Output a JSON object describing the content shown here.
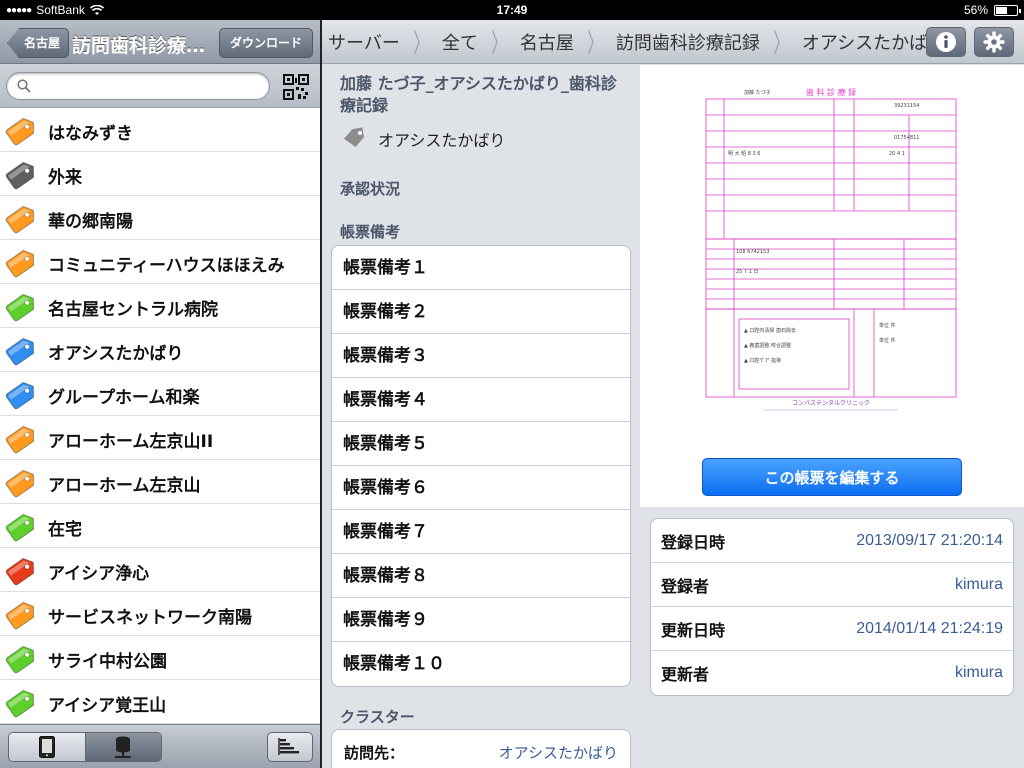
{
  "status": {
    "carrier": "SoftBank",
    "time": "17:49",
    "battery": "56%",
    "battery_level": 0.56
  },
  "left": {
    "back_label": "名古屋",
    "title": "訪問歯科診療…",
    "download_label": "ダウンロード",
    "search": {
      "placeholder": "",
      "value": ""
    },
    "items": [
      {
        "label": "はなみずき",
        "color": "#ff9a1f"
      },
      {
        "label": "外来",
        "color": "#5f5f5f"
      },
      {
        "label": "華の郷南陽",
        "color": "#ff9a1f"
      },
      {
        "label": "コミュニティーハウスほほえみ",
        "color": "#ff9a1f"
      },
      {
        "label": "名古屋セントラル病院",
        "color": "#5fcf2a"
      },
      {
        "label": "オアシスたかばり",
        "color": "#2f8ef0"
      },
      {
        "label": "グループホーム和楽",
        "color": "#2f8ef0"
      },
      {
        "label": "アローホーム左京山II",
        "color": "#ff9a1f"
      },
      {
        "label": "アローホーム左京山",
        "color": "#ff9a1f"
      },
      {
        "label": "在宅",
        "color": "#5fcf2a"
      },
      {
        "label": "アイシア浄心",
        "color": "#e83a1a"
      },
      {
        "label": "サービスネットワーク南陽",
        "color": "#ff9a1f"
      },
      {
        "label": "サライ中村公園",
        "color": "#5fcf2a"
      },
      {
        "label": "アイシア覚王山",
        "color": "#5fcf2a"
      }
    ]
  },
  "breadcrumb": [
    "サーバー",
    "全て",
    "名古屋",
    "訪問歯科診療記録",
    "オアシスたかばり"
  ],
  "doc": {
    "title": "加藤 たづ子_オアシスたかばり_歯科診療記録",
    "tag": "オアシスたかばり",
    "approval_header": "承認状況",
    "remarks_header": "帳票備考",
    "remarks": [
      "帳票備考１",
      "帳票備考２",
      "帳票備考３",
      "帳票備考４",
      "帳票備考５",
      "帳票備考６",
      "帳票備考７",
      "帳票備考８",
      "帳票備考９",
      "帳票備考１０"
    ],
    "cluster_header": "クラスター",
    "cluster": {
      "key": "訪問先：",
      "value": "オアシスたかばり"
    }
  },
  "preview": {
    "form_title": "歯 科 診 療 録",
    "clinic": "コンパスデンタルクリニック",
    "edit_label": "この帳票を編集する"
  },
  "meta": [
    {
      "key": "登録日時",
      "value": "2013/09/17 21:20:14"
    },
    {
      "key": "登録者",
      "value": "kimura"
    },
    {
      "key": "更新日時",
      "value": "2014/01/14 21:24:19"
    },
    {
      "key": "更新者",
      "value": "kimura"
    }
  ]
}
